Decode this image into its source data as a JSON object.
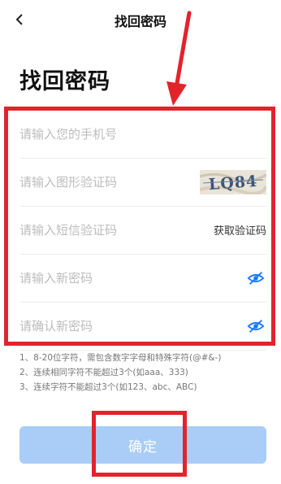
{
  "nav": {
    "title": "找回密码"
  },
  "page": {
    "title": "找回密码"
  },
  "form": {
    "phone_placeholder": "请输入您的手机号",
    "captcha_placeholder": "请输入图形验证码",
    "captcha_text": "LQ84",
    "sms_placeholder": "请输入短信验证码",
    "sms_button": "获取验证码",
    "new_password_placeholder": "请输入新密码",
    "confirm_password_placeholder": "请确认新密码"
  },
  "hints": [
    "1、8-20位字符，需包含数字字母和特殊字符(@#&-)",
    "2、连续相同字符不能超过3个(如aaa、333)",
    "3、连续字符不能超过3个(如123、abc、ABC)"
  ],
  "confirm_button": "确定",
  "colors": {
    "accent": "#1677ff",
    "button_bg": "#a9cdf7",
    "annotation": "#e3232c"
  },
  "icons": {
    "back": "chevron-left-icon",
    "password_visibility": "eye-off-icon"
  }
}
